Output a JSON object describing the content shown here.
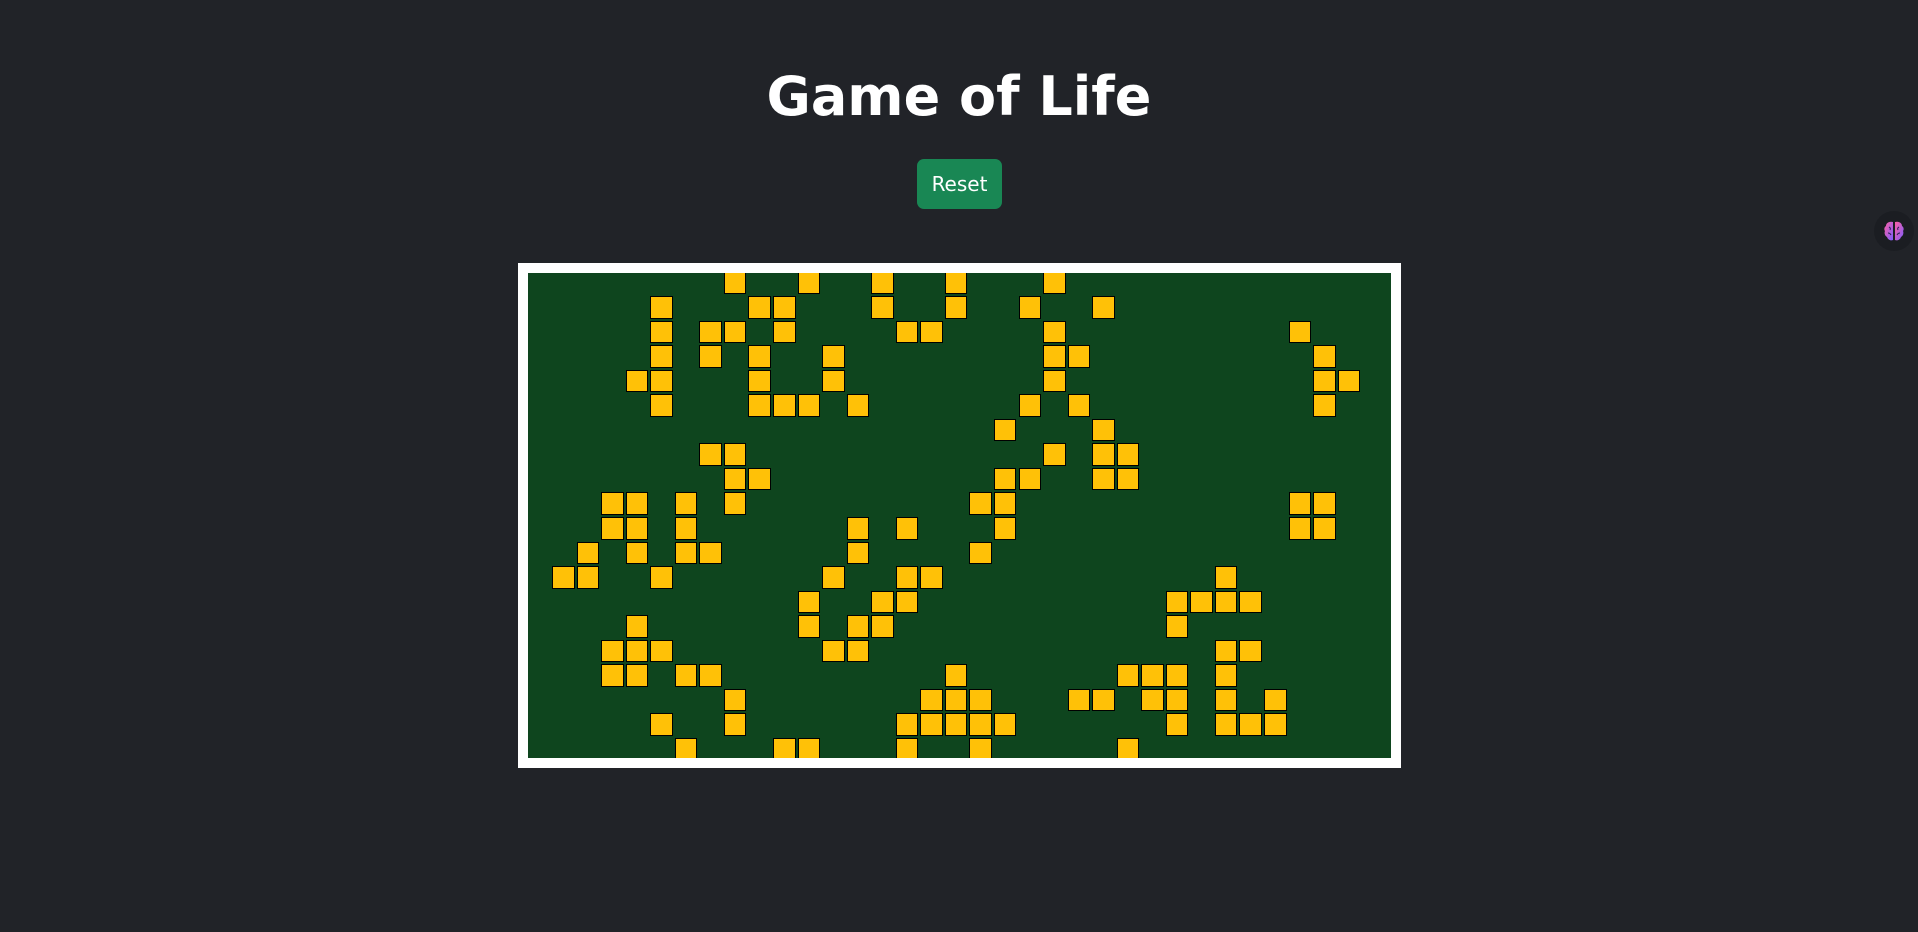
{
  "title": "Game of Life",
  "reset_label": "Reset",
  "colors": {
    "background": "#212328",
    "board": "#0e451e",
    "live_cell": "#ffc107",
    "button": "#198754"
  },
  "grid": {
    "cols": 35,
    "rows": 20,
    "live_cells": [
      [
        0,
        8
      ],
      [
        0,
        11
      ],
      [
        0,
        14
      ],
      [
        0,
        17
      ],
      [
        0,
        21
      ],
      [
        1,
        5
      ],
      [
        1,
        9
      ],
      [
        1,
        10
      ],
      [
        1,
        14
      ],
      [
        1,
        17
      ],
      [
        1,
        20
      ],
      [
        1,
        23
      ],
      [
        2,
        5
      ],
      [
        2,
        7
      ],
      [
        2,
        8
      ],
      [
        2,
        10
      ],
      [
        2,
        15
      ],
      [
        2,
        16
      ],
      [
        2,
        21
      ],
      [
        2,
        31
      ],
      [
        3,
        5
      ],
      [
        3,
        7
      ],
      [
        3,
        9
      ],
      [
        3,
        12
      ],
      [
        3,
        21
      ],
      [
        3,
        22
      ],
      [
        3,
        32
      ],
      [
        4,
        4
      ],
      [
        4,
        5
      ],
      [
        4,
        9
      ],
      [
        4,
        12
      ],
      [
        4,
        21
      ],
      [
        4,
        32
      ],
      [
        4,
        33
      ],
      [
        5,
        5
      ],
      [
        5,
        9
      ],
      [
        5,
        10
      ],
      [
        5,
        11
      ],
      [
        5,
        13
      ],
      [
        5,
        20
      ],
      [
        5,
        22
      ],
      [
        5,
        32
      ],
      [
        6,
        19
      ],
      [
        6,
        23
      ],
      [
        7,
        7
      ],
      [
        7,
        8
      ],
      [
        7,
        21
      ],
      [
        7,
        23
      ],
      [
        7,
        24
      ],
      [
        8,
        8
      ],
      [
        8,
        9
      ],
      [
        8,
        19
      ],
      [
        8,
        20
      ],
      [
        8,
        23
      ],
      [
        8,
        24
      ],
      [
        9,
        3
      ],
      [
        9,
        4
      ],
      [
        9,
        6
      ],
      [
        9,
        8
      ],
      [
        9,
        18
      ],
      [
        9,
        19
      ],
      [
        9,
        31
      ],
      [
        9,
        32
      ],
      [
        10,
        3
      ],
      [
        10,
        4
      ],
      [
        10,
        6
      ],
      [
        10,
        13
      ],
      [
        10,
        15
      ],
      [
        10,
        19
      ],
      [
        10,
        31
      ],
      [
        10,
        32
      ],
      [
        11,
        2
      ],
      [
        11,
        4
      ],
      [
        11,
        6
      ],
      [
        11,
        7
      ],
      [
        11,
        13
      ],
      [
        11,
        18
      ],
      [
        12,
        1
      ],
      [
        12,
        2
      ],
      [
        12,
        5
      ],
      [
        12,
        12
      ],
      [
        12,
        15
      ],
      [
        12,
        16
      ],
      [
        12,
        28
      ],
      [
        13,
        11
      ],
      [
        13,
        14
      ],
      [
        13,
        15
      ],
      [
        13,
        26
      ],
      [
        13,
        27
      ],
      [
        13,
        28
      ],
      [
        13,
        29
      ],
      [
        14,
        4
      ],
      [
        14,
        11
      ],
      [
        14,
        13
      ],
      [
        14,
        14
      ],
      [
        14,
        26
      ],
      [
        15,
        3
      ],
      [
        15,
        4
      ],
      [
        15,
        5
      ],
      [
        15,
        12
      ],
      [
        15,
        13
      ],
      [
        15,
        28
      ],
      [
        15,
        29
      ],
      [
        16,
        3
      ],
      [
        16,
        4
      ],
      [
        16,
        6
      ],
      [
        16,
        7
      ],
      [
        16,
        17
      ],
      [
        16,
        24
      ],
      [
        16,
        25
      ],
      [
        16,
        26
      ],
      [
        16,
        28
      ],
      [
        17,
        8
      ],
      [
        17,
        16
      ],
      [
        17,
        17
      ],
      [
        17,
        18
      ],
      [
        17,
        22
      ],
      [
        17,
        23
      ],
      [
        17,
        25
      ],
      [
        17,
        26
      ],
      [
        17,
        28
      ],
      [
        17,
        30
      ],
      [
        18,
        5
      ],
      [
        18,
        8
      ],
      [
        18,
        15
      ],
      [
        18,
        16
      ],
      [
        18,
        17
      ],
      [
        18,
        18
      ],
      [
        18,
        19
      ],
      [
        18,
        26
      ],
      [
        18,
        28
      ],
      [
        18,
        29
      ],
      [
        18,
        30
      ],
      [
        19,
        6
      ],
      [
        19,
        10
      ],
      [
        19,
        11
      ],
      [
        19,
        15
      ],
      [
        19,
        18
      ],
      [
        19,
        24
      ]
    ]
  }
}
